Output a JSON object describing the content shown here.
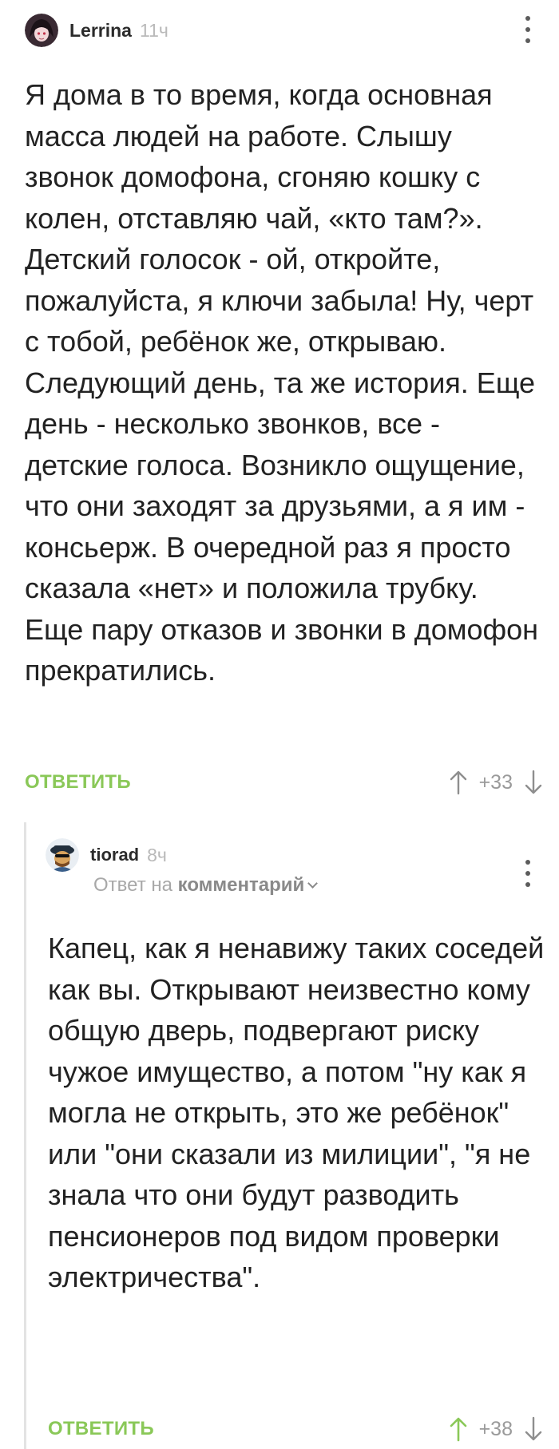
{
  "comments": [
    {
      "username": "Lerrina",
      "time": "11ч",
      "text": "Я дома в то время, когда основная масса людей на работе. Слышу звонок домофона, сгоняю кошку с колен, отставляю чай, «кто там?». Детский голосок - ой, откройте, пожалуйста, я ключи забыла! Ну, черт с тобой, ребёнок же, открываю. Следующий день, та же история. Еще день - несколько звонков, все - детские голоса. Возникло ощущение, что они заходят за друзьями, а я им - консьерж. В очередной раз я просто сказала «нет» и положила трубку. Еще пару отказов и звонки в домофон прекратились.",
      "reply_label": "ОТВЕТИТЬ",
      "score": "+33"
    },
    {
      "username": "tiorad",
      "time": "8ч",
      "reply_prefix": "Ответ на",
      "reply_target": "комментарий",
      "text": "Капец, как я ненавижу таких соседей как вы. Открывают неизвестно кому общую дверь, подвергают риску чужое имущество, а потом \"ну как я могла не открыть, это же ребёнок\" или \"они сказали из милиции\", \"я не знала что они будут разводить пенсионеров под видом проверки электричества\".",
      "reply_label": "ОТВЕТИТЬ",
      "score": "+38"
    }
  ],
  "colors": {
    "accent_green": "#8ac858",
    "text": "#222222",
    "muted": "#b9b9b9"
  },
  "icons": [
    "avatar",
    "more-vertical-icon",
    "chevron-down-icon",
    "arrow-up-icon",
    "arrow-down-icon"
  ]
}
